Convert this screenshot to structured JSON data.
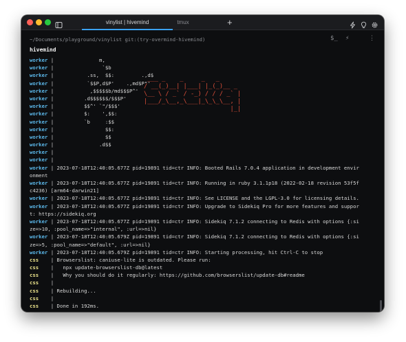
{
  "window": {
    "tabs": [
      {
        "label": "vinylist | hivemind",
        "active": true
      },
      {
        "label": "tmux",
        "active": false
      }
    ],
    "new_tab": "+",
    "accent": "#3ba3f7",
    "icons": [
      "sidebar-icon",
      "lightning-icon",
      "lightbulb-icon",
      "gear-icon"
    ]
  },
  "header": {
    "path": "~/Documents/playground/vinylist git:(try-overmind-hivemind)",
    "actions": [
      "$_",
      "⚡",
      "⋮"
    ],
    "session": "hivemind"
  },
  "art_text": " ___ _    _     _   _\n/ __(_)__| |___| |_(_)__ _\n\\__ \\ / _` / -_) / / / _` |\n|___/_\\__,_\\___|_\\_\\_\\__, |\n                        |_|",
  "colors": {
    "worker": "#5cb8ea",
    "css": "#e8e08a",
    "art": "#e0503a"
  },
  "lines": [
    {
      "proc": "worker",
      "sep": " | ",
      "text": "              m,"
    },
    {
      "proc": "worker",
      "sep": " | ",
      "text": "               `$b"
    },
    {
      "proc": "worker",
      "sep": " | ",
      "text": "          .ss,  $$:         .,d$"
    },
    {
      "proc": "worker",
      "sep": " | ",
      "text": "          `$$P,d$P'    .,md$P\"'"
    },
    {
      "proc": "worker",
      "sep": " | ",
      "text": "           ,$$$$$b/md$$$P^'"
    },
    {
      "proc": "worker",
      "sep": " | ",
      "text": "         .d$$$$$$/$$$P'"
    },
    {
      "proc": "worker",
      "sep": " | ",
      "text": "         $$^' `\"/$$$'"
    },
    {
      "proc": "worker",
      "sep": " | ",
      "text": "         $:    ',$$:"
    },
    {
      "proc": "worker",
      "sep": " | ",
      "text": "         `b     :$$"
    },
    {
      "proc": "worker",
      "sep": " | ",
      "text": "                $$:"
    },
    {
      "proc": "worker",
      "sep": " | ",
      "text": "                $$"
    },
    {
      "proc": "worker",
      "sep": " | ",
      "text": "              .d$$"
    },
    {
      "proc": "worker",
      "sep": " | ",
      "text": ""
    },
    {
      "proc": "worker",
      "sep": " | ",
      "text": ""
    },
    {
      "proc": "worker",
      "sep": " | ",
      "text": "2023-07-18T12:40:05.677Z pid=19891 tid=ctr INFO: Booted Rails 7.0.4 application in development envir"
    },
    {
      "proc": "",
      "sep": "",
      "text": "onment"
    },
    {
      "proc": "worker",
      "sep": " | ",
      "text": "2023-07-18T12:40:05.677Z pid=19891 tid=ctr INFO: Running in ruby 3.1.1p18 (2022-02-18 revision 53f5f"
    },
    {
      "proc": "",
      "sep": "",
      "text": "c4236) [arm64-darwin21]"
    },
    {
      "proc": "worker",
      "sep": " | ",
      "text": "2023-07-18T12:40:05.677Z pid=19891 tid=ctr INFO: See LICENSE and the LGPL-3.0 for licensing details."
    },
    {
      "proc": "worker",
      "sep": " | ",
      "text": "2023-07-18T12:40:05.677Z pid=19891 tid=ctr INFO: Upgrade to Sidekiq Pro for more features and suppor"
    },
    {
      "proc": "",
      "sep": "",
      "text": "t: https://sidekiq.org"
    },
    {
      "proc": "worker",
      "sep": " | ",
      "text": "2023-07-18T12:40:05.677Z pid=19891 tid=ctr INFO: Sidekiq 7.1.2 connecting to Redis with options {:si"
    },
    {
      "proc": "",
      "sep": "",
      "text": "ze=>10, :pool_name=>\"internal\", :url=>nil}"
    },
    {
      "proc": "worker",
      "sep": " | ",
      "text": "2023-07-18T12:40:05.679Z pid=19891 tid=ctr INFO: Sidekiq 7.1.2 connecting to Redis with options {:si"
    },
    {
      "proc": "",
      "sep": "",
      "text": "ze=>5, :pool_name=>\"default\", :url=>nil}"
    },
    {
      "proc": "worker",
      "sep": " | ",
      "text": "2023-07-18T12:40:05.679Z pid=19891 tid=ctr INFO: Starting processing, hit Ctrl-C to stop"
    },
    {
      "proc": "css",
      "sep": "    | ",
      "text": "Browserslist: caniuse-lite is outdated. Please run:"
    },
    {
      "proc": "css",
      "sep": "    | ",
      "text": "  npx update-browserslist-db@latest"
    },
    {
      "proc": "css",
      "sep": "    | ",
      "text": "  Why you should do it regularly: https://github.com/browserslist/update-db#readme"
    },
    {
      "proc": "css",
      "sep": "    | ",
      "text": ""
    },
    {
      "proc": "css",
      "sep": "    | ",
      "text": "Rebuilding..."
    },
    {
      "proc": "css",
      "sep": "    | ",
      "text": ""
    },
    {
      "proc": "css",
      "sep": "    | ",
      "text": "Done in 192ms."
    }
  ]
}
